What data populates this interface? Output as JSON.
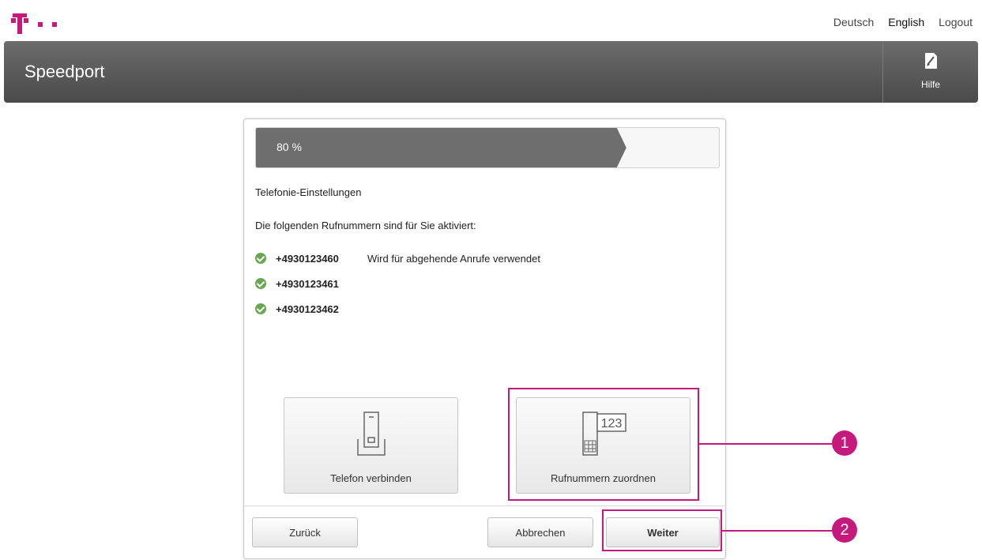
{
  "top_bar": {
    "languages": [
      "Deutsch",
      "English"
    ],
    "logout_label": "Logout"
  },
  "header": {
    "brand": "Speedport",
    "help_label": "Hilfe",
    "help_icon": "help-document-icon"
  },
  "wizard": {
    "progress": {
      "label": "80 %",
      "value": 0.8
    },
    "section_title": "Telefonie-Einstellungen",
    "info_text": "Die folgenden Rufnummern sind für Sie aktiviert:",
    "numbers": [
      {
        "number": "+4930123460",
        "note": "Wird für abgehende Anrufe verwendet"
      },
      {
        "number": "+4930123461",
        "note": ""
      },
      {
        "number": "+4930123462",
        "note": ""
      }
    ],
    "tiles": {
      "connect_phone": {
        "label": "Telefon verbinden",
        "icon": "phone-base-station-icon"
      },
      "assign_numbers": {
        "label": "Rufnummern zuordnen",
        "icon": "phone-number-assign-icon",
        "icon_text": "123"
      }
    },
    "buttons": {
      "back": "Zurück",
      "cancel": "Abbrechen",
      "next": "Weiter"
    }
  },
  "callouts": [
    "1",
    "2"
  ],
  "colors": {
    "brand_magenta": "#c5197d",
    "header_gray": "#5a5a5a",
    "progress_fill": "#6e6e6e",
    "check_green": "#6aa84f"
  }
}
